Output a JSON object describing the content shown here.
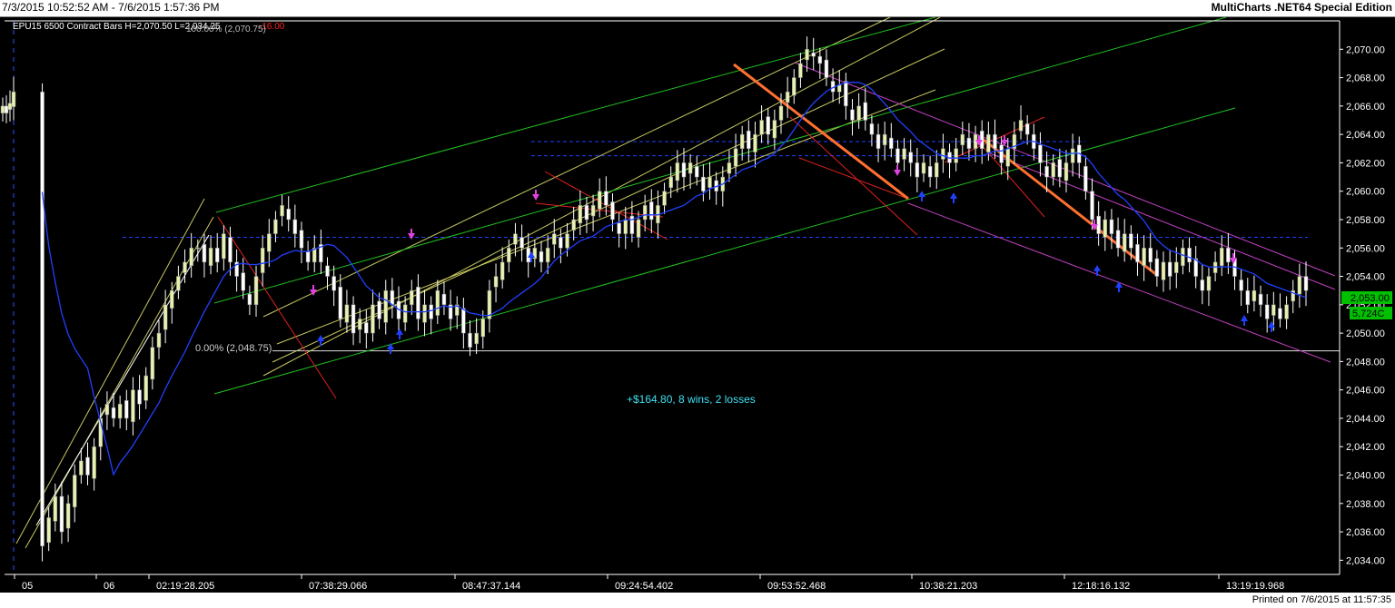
{
  "header": {
    "date_range": "7/3/2015 10:52:52 AM - 7/6/2015 1:57:36 PM",
    "app_title": "MultiCharts .NET64 Special Edition"
  },
  "footer": {
    "printed": "Printed on 7/6/2015 at 11:57:35"
  },
  "chart_data": {
    "type": "candlestick",
    "symbol_info": "EPU15  6500 Contract Bars  H=2,070.50  L=2,034.25",
    "change": "-16.00",
    "fib_top_label": "100.00% (2,070.75)",
    "fib_bottom_label": "0.00% (2,048.75)",
    "fib_bottom_value": 2048.75,
    "annotation": "+$164.80, 8 wins, 2 losses",
    "last_price_label": "2,053.00",
    "last_price": 2053.0,
    "volume_label": "5,724C",
    "ylim": [
      2033,
      2072
    ],
    "y_ticks": [
      "2,034.00",
      "2,036.00",
      "2,038.00",
      "2,040.00",
      "2,042.00",
      "2,044.00",
      "2,046.00",
      "2,048.00",
      "2,050.00",
      "2,052.00",
      "2,054.00",
      "2,056.00",
      "2,058.00",
      "2,060.00",
      "2,062.00",
      "2,064.00",
      "2,066.00",
      "2,068.00",
      "2,070.00"
    ],
    "y_tick_values": [
      2034,
      2036,
      2038,
      2040,
      2042,
      2044,
      2046,
      2048,
      2050,
      2052,
      2054,
      2056,
      2058,
      2060,
      2062,
      2064,
      2066,
      2068,
      2070
    ],
    "x_ticks": [
      "05",
      "06",
      "02:19:28.205",
      "07:38:29.066",
      "08:47:37.144",
      "09:24:54.402",
      "09:53:52.468",
      "10:38:21.203",
      "12:18:16.132",
      "13:19:19.968"
    ],
    "dashed_levels": [
      2056.75,
      2062.5,
      2063.5
    ],
    "closes": [
      2066,
      2065.5,
      2066.2,
      2067,
      2035,
      2037,
      2038.5,
      2036,
      2038,
      2040,
      2041,
      2040,
      2042,
      2044,
      2045,
      2044,
      2045,
      2044,
      2046,
      2045,
      2047,
      2049,
      2050,
      2052,
      2053,
      2054,
      2055,
      2056,
      2056,
      2055,
      2056,
      2055,
      2057,
      2055,
      2054,
      2053,
      2052,
      2054,
      2056,
      2057,
      2058,
      2059,
      2058,
      2057,
      2056,
      2055,
      2056,
      2055,
      2054,
      2053,
      2051,
      2052,
      2050,
      2051,
      2050,
      2052,
      2051,
      2053,
      2052,
      2051,
      2052,
      2053,
      2051,
      2052,
      2051,
      2053,
      2052,
      2051,
      2052,
      2050,
      2049,
      2050,
      2051,
      2053,
      2054,
      2055,
      2056,
      2057,
      2056,
      2055,
      2056,
      2055,
      2056,
      2057,
      2056,
      2057,
      2058,
      2059,
      2058,
      2059,
      2060,
      2059,
      2058,
      2057,
      2058,
      2057,
      2058,
      2059,
      2058,
      2059,
      2060,
      2061,
      2062,
      2061,
      2062,
      2061,
      2060,
      2061,
      2060,
      2061,
      2062,
      2063,
      2064,
      2063,
      2064,
      2065,
      2064,
      2065,
      2066,
      2067,
      2068,
      2069,
      2070,
      2069.5,
      2069,
      2068,
      2067,
      2067.5,
      2066,
      2065,
      2066,
      2065,
      2064,
      2063,
      2064,
      2063,
      2062,
      2063,
      2062,
      2061,
      2062,
      2061,
      2062,
      2063,
      2062,
      2063,
      2064,
      2063,
      2064,
      2063,
      2064,
      2063,
      2062,
      2063,
      2064,
      2065,
      2064,
      2063,
      2062,
      2061,
      2062,
      2061,
      2062,
      2063,
      2062,
      2060,
      2058,
      2057,
      2058,
      2057,
      2056,
      2057,
      2056,
      2055,
      2056,
      2055,
      2054,
      2055,
      2054,
      2055,
      2056,
      2055,
      2054,
      2053,
      2054,
      2055,
      2056,
      2055,
      2054,
      2053,
      2052,
      2053,
      2052,
      2051,
      2052,
      2051,
      2052,
      2053,
      2054,
      2053
    ]
  }
}
